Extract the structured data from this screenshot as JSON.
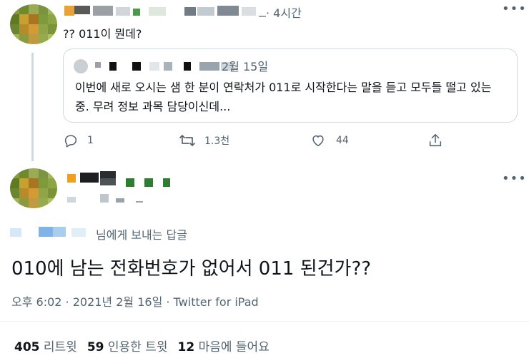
{
  "parent_tweet": {
    "time": "· 4시간",
    "text": "?? 011이 뭔데?",
    "more_icon": "ellipsis-icon"
  },
  "quoted_tweet": {
    "date": "2월 15일",
    "text": "이번에 새로 오시는 샘 한 분이 연락처가 011로 시작한다는 말을 듣고 모두들 떨고 있는 중. 무려 정보 과목 담당이신데..."
  },
  "parent_actions": {
    "reply_count": "1",
    "retweet_count": "1.3천",
    "like_count": "44"
  },
  "main_tweet": {
    "replying_to": "님에게 보내는 답글",
    "text": "010에 남는 전화번호가 없어서 011 된건가??",
    "meta": "오후 6:02 · 2021년 2월 16일 · Twitter for iPad"
  },
  "stats": {
    "retweets_count": "405",
    "retweets_label": "리트윗",
    "quotes_count": "59",
    "quotes_label": "인용한 트윗",
    "likes_count": "12",
    "likes_label": "마음에 들어요"
  },
  "colors": {
    "text": "#0f1419",
    "muted": "#536471",
    "border": "#cfd9de"
  }
}
